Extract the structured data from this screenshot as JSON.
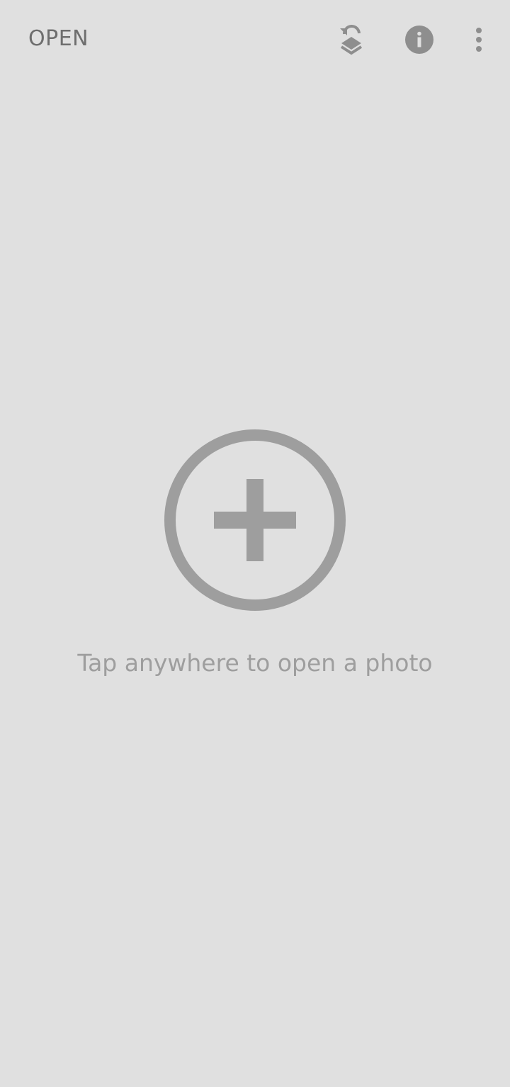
{
  "topbar": {
    "open_label": "OPEN",
    "icons": {
      "layers_reset": "layers-undo-icon",
      "info": "info-icon",
      "more": "more-vert-icon"
    }
  },
  "main": {
    "hint_text": "Tap anywhere to open a photo",
    "add_icon": "add-circle-icon"
  },
  "colors": {
    "background": "#e0e0e0",
    "text_primary": "#6e6e6e",
    "icon_gray": "#8e8e8e",
    "hint_gray": "#9e9e9e"
  }
}
